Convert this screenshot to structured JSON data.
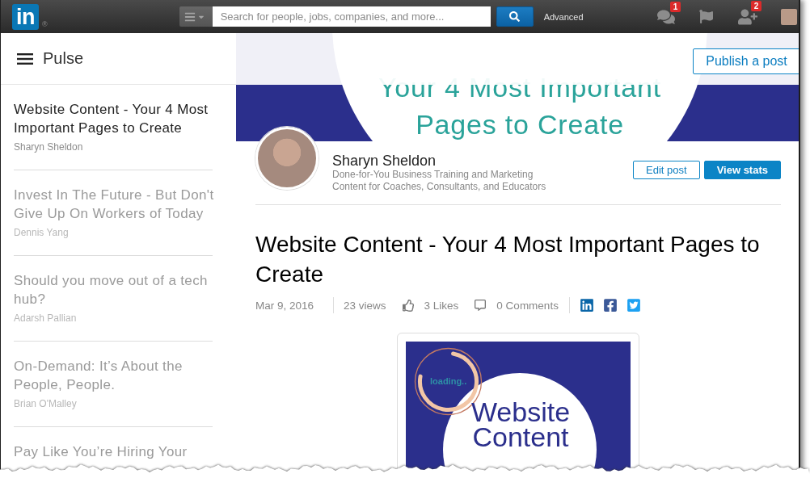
{
  "topbar": {
    "logo": {
      "text": "in",
      "mark": "®"
    },
    "search": {
      "placeholder": "Search for people, jobs, companies, and more..."
    },
    "advanced_link": "Advanced",
    "notifications": [
      {
        "kind": "messages",
        "badge": "1"
      },
      {
        "kind": "flag"
      },
      {
        "kind": "connections",
        "badge": "2"
      }
    ]
  },
  "sidebar": {
    "title": "Pulse",
    "posts": [
      {
        "title": "Website Content - Your 4 Most Important Pages to Create",
        "author": "Sharyn Sheldon",
        "selected": true
      },
      {
        "title": "Invest In The Future - But Don't Give Up On Workers of Today",
        "author": "Dennis Yang",
        "selected": false
      },
      {
        "title": "Should you move out of a tech hub?",
        "author": "Adarsh Pallian",
        "selected": false
      },
      {
        "title": "On-Demand: It’s About the People, People.",
        "author": "Brian O'Malley",
        "selected": false
      },
      {
        "title": "Pay Like You’re Hiring Your",
        "selected": false
      }
    ]
  },
  "header": {
    "publish_button": "Publish a post"
  },
  "cover_image": {
    "lines": [
      "Your 4 Most Important",
      "Pages to Create"
    ]
  },
  "author": {
    "name": "Sharyn Sheldon",
    "headline": "Done-for-You Business Training and Marketing Content for Coaches, Consultants, and Educators"
  },
  "post_actions": [
    {
      "label": "Edit post",
      "kind": "outline"
    },
    {
      "label": "View stats",
      "kind": "primary"
    }
  ],
  "article": {
    "title": "Website Content - Your 4 Most Important Pages to Create",
    "date": "Mar 9, 2016",
    "views": "23 views",
    "likes": "3 Likes",
    "comments": "0 Comments",
    "share": [
      {
        "kind": "linkedin"
      },
      {
        "kind": "facebook"
      },
      {
        "kind": "twitter"
      }
    ]
  },
  "article_image": {
    "loading_text": "loading..",
    "lines": [
      "Website",
      "Content"
    ]
  }
}
